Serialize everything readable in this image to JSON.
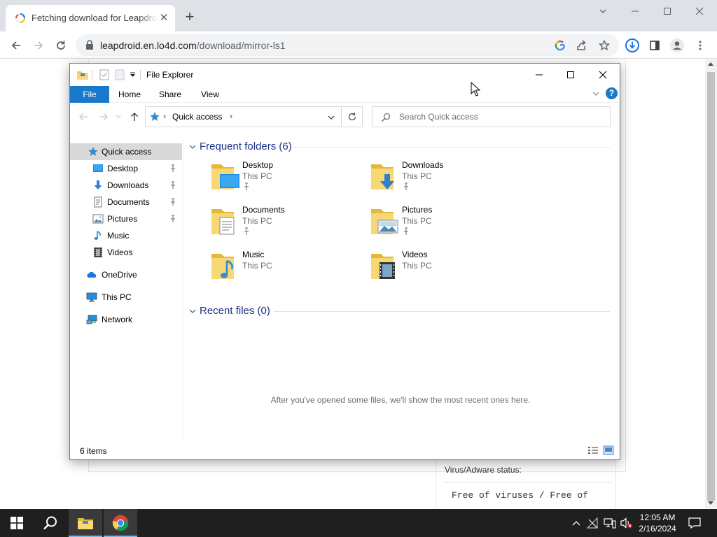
{
  "browser": {
    "tab_title": "Fetching download for Leapdroid",
    "url_host": "leapdroid.en.lo4d.com",
    "url_path": "/download/mirror-ls1"
  },
  "web_page": {
    "status_label": "Virus/Adware status:",
    "status_value": "Free of viruses / Free of"
  },
  "explorer": {
    "title": "File Explorer",
    "ribbon_tabs": [
      "File",
      "Home",
      "Share",
      "View"
    ],
    "address": "Quick access",
    "search_placeholder": "Search Quick access",
    "nav": {
      "quick_access": "Quick access",
      "items": [
        {
          "label": "Desktop",
          "pinned": true
        },
        {
          "label": "Downloads",
          "pinned": true
        },
        {
          "label": "Documents",
          "pinned": true
        },
        {
          "label": "Pictures",
          "pinned": true
        },
        {
          "label": "Music",
          "pinned": false
        },
        {
          "label": "Videos",
          "pinned": false
        }
      ],
      "onedrive": "OneDrive",
      "this_pc": "This PC",
      "network": "Network"
    },
    "frequent_header": "Frequent folders (6)",
    "folders": [
      {
        "name": "Desktop",
        "location": "This PC",
        "pinned": true
      },
      {
        "name": "Downloads",
        "location": "This PC",
        "pinned": true
      },
      {
        "name": "Documents",
        "location": "This PC",
        "pinned": true
      },
      {
        "name": "Pictures",
        "location": "This PC",
        "pinned": true
      },
      {
        "name": "Music",
        "location": "This PC",
        "pinned": false
      },
      {
        "name": "Videos",
        "location": "This PC",
        "pinned": false
      }
    ],
    "recent_header": "Recent files (0)",
    "recent_empty": "After you've opened some files, we'll show the most recent ones here.",
    "status_items": "6 items"
  },
  "taskbar": {
    "time": "12:05 AM",
    "date": "2/16/2024"
  },
  "colors": {
    "accent_blue": "#1979ca",
    "section_header": "#1e3287",
    "taskbar": "#1f1f1f"
  }
}
